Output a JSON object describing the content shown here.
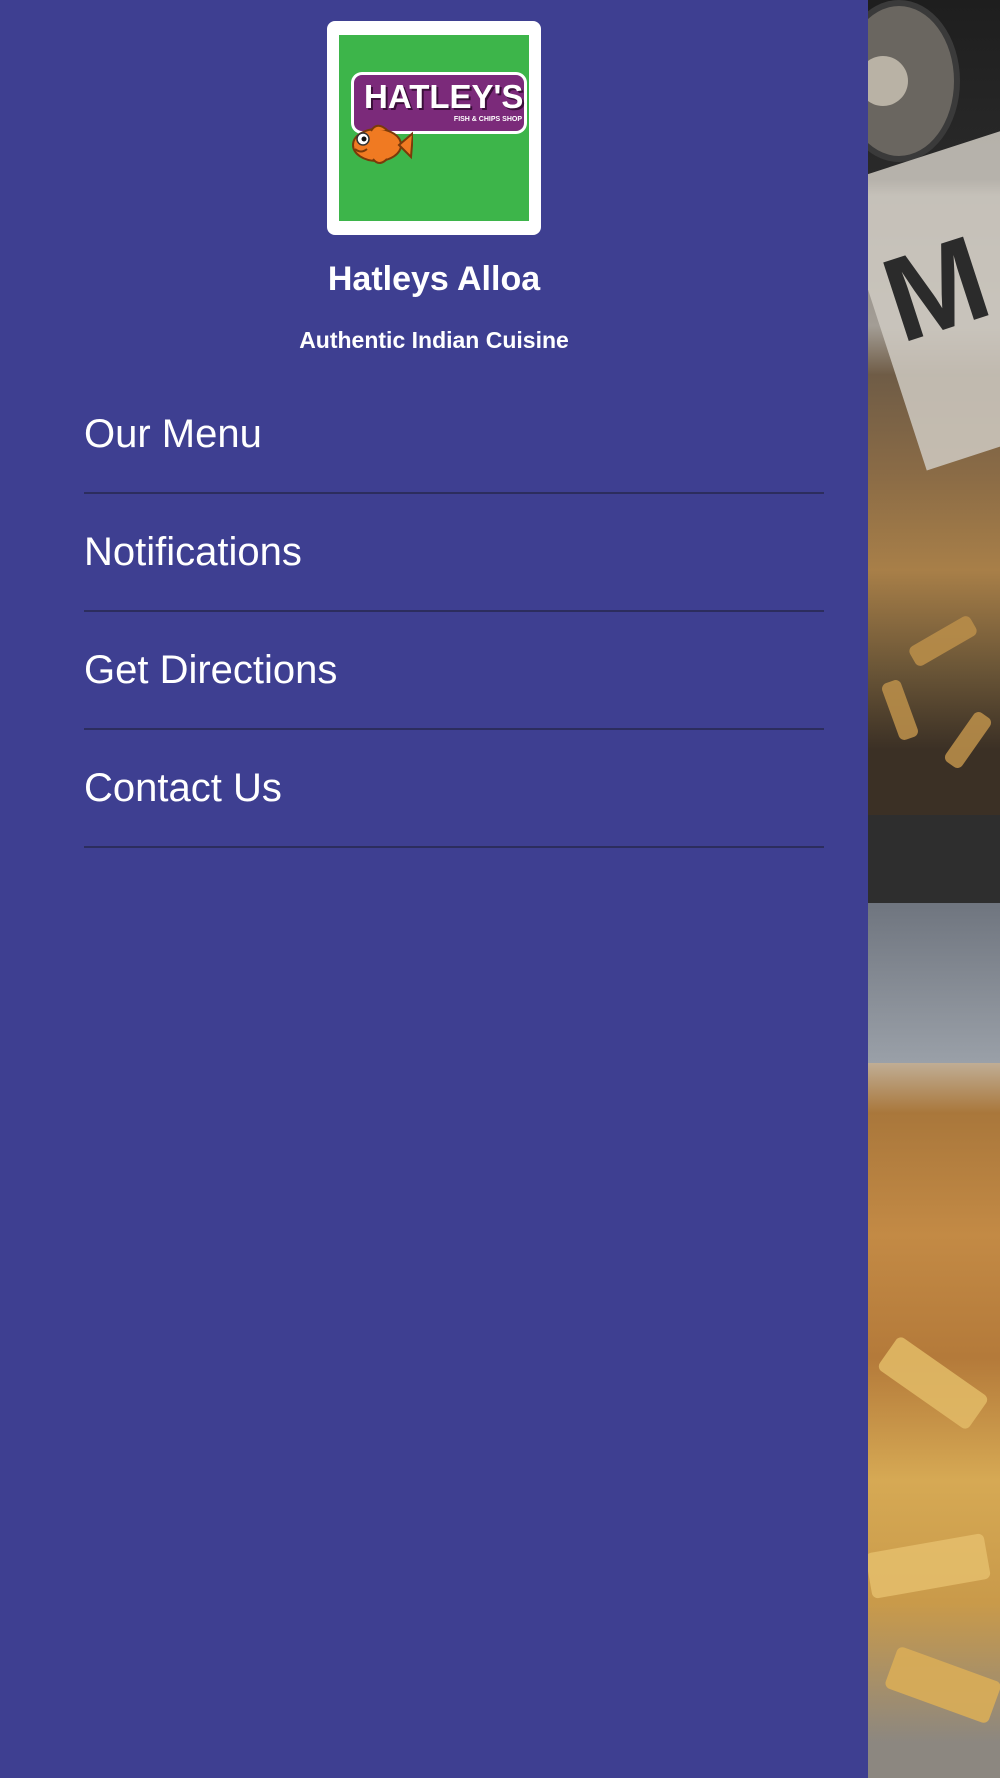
{
  "brand": {
    "logo_text": "HATLEY'S",
    "logo_tagline": "FISH & CHIPS SHOP",
    "logo_colors": {
      "background": "#3db54a",
      "banner": "#7b2a7a",
      "fish": "#f07a22"
    }
  },
  "drawer": {
    "title": "Hatleys Alloa",
    "subtitle": "Authentic Indian Cuisine",
    "background_color": "#3e3f91",
    "menu_items": [
      {
        "label": "Our Menu"
      },
      {
        "label": "Notifications"
      },
      {
        "label": "Get Directions"
      },
      {
        "label": "Contact Us"
      }
    ]
  }
}
